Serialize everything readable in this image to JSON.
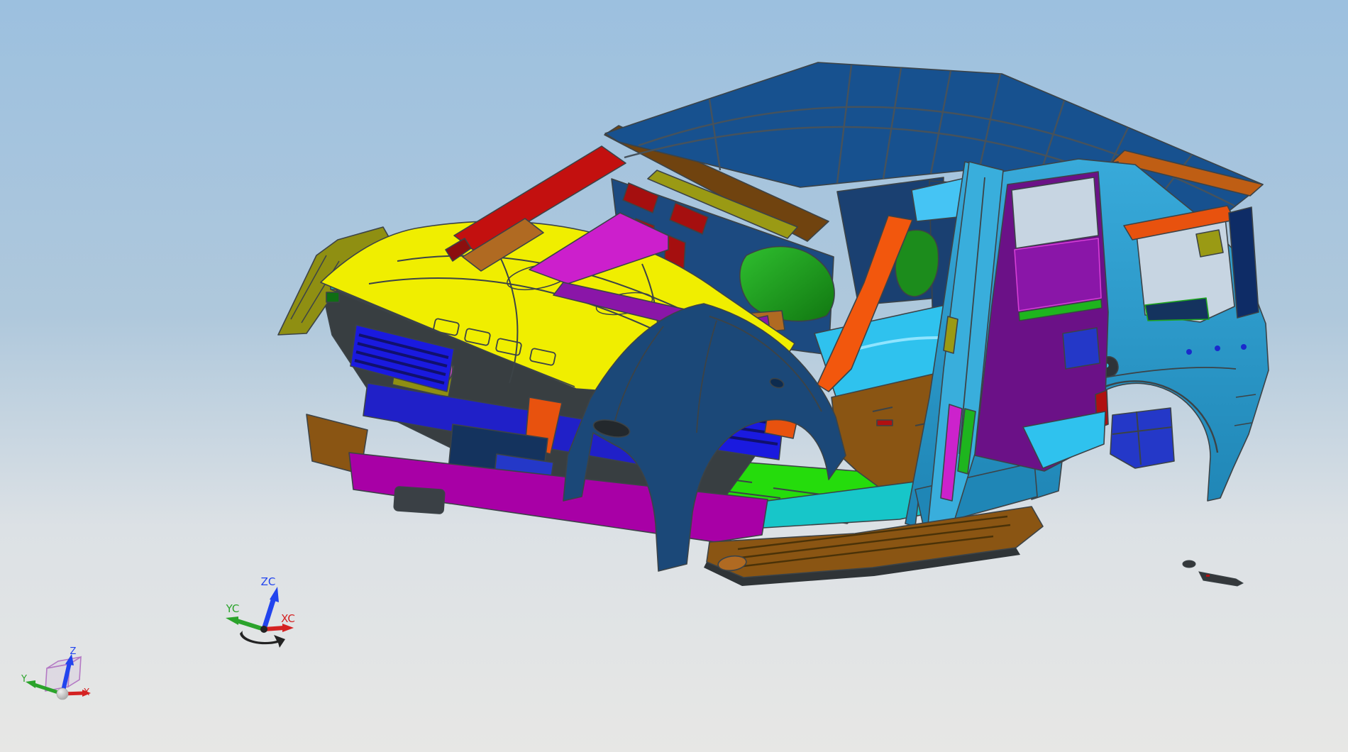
{
  "viewport": {
    "type": "cad-3d-viewport",
    "background": {
      "top": "#9CC0DF",
      "upper_mid": "#AFC8DC",
      "lower_mid": "#DCE1E5",
      "bottom": "#E7E7E5"
    }
  },
  "model": {
    "name": "suv-body-in-white",
    "description": "Multi-colored CAD body-in-white of an SUV viewed from front-left above"
  },
  "palette": {
    "edge": "#3C4347",
    "triad_blue": "#2244EE",
    "triad_green": "#2BA32B",
    "triad_red": "#D42222",
    "cube_purple": "#B479C4",
    "sphere_light": "#EFEFEF",
    "wcs_dark": "#232323"
  },
  "parts": {
    "roof": "#17518F",
    "roof_grid": "#46525C",
    "roof_edge_orange": "#BF5E14",
    "hood": "#F0EE00",
    "bodyside": "#38AADA",
    "bodyside_lower": "#1E84B4",
    "front_fender": "#1B4878",
    "a_pillar_orange": "#F2570D",
    "header_brown": "#70430F",
    "header_olive": "#9A9A14",
    "windshield_red": "#C3100F",
    "visor_red": "#A50F0F",
    "dark_red": "#8C0F0F",
    "copper": "#B06A22",
    "cowl_magenta": "#CC1FCC",
    "cowl_purple": "#8A16A8",
    "dash_blue": "#1C4A80",
    "interior_blue": "#1A4071",
    "seat_green": "#1C8C1C",
    "floor_green": "#25DC0C",
    "floor_cyan": "#2FC2EE",
    "floor_brown": "#8A5513",
    "sill_teal": "#17C6C9",
    "dark_sill": "#1F86B6",
    "grille_blue": "#1A1ADF",
    "beam_blue": "#2020C8",
    "bumper_magenta": "#A800A6",
    "fascia_dark": "#383E41",
    "olive": "#8F8F12",
    "pink_block": "#D551D0",
    "fan_pink": "#CC49CC",
    "green_strip": "#17B517",
    "bright_green": "#2ADB12",
    "orange_bracket": "#E8520E",
    "navy_box": "#14335E",
    "royal_blue": "#2438C8",
    "b_pillar": "#39AEDC",
    "sky_strip": "#45C4F4",
    "quarter_purple": "#6B1187",
    "trim_purple": "#8A16A8",
    "magenta_strip": "#CC22CC",
    "green_pillar_strip": "#1EB51E",
    "pillar_navy": "#0E2C66",
    "window_bg": "#C7D5E2",
    "recess_dark": "#2E3338",
    "dot_blue": "#1A2ACC",
    "yellow_patch": "#E8E400",
    "red_speck": "#B01010",
    "hitch_dark": "#3A4045",
    "debris": "#34383B",
    "shadow": "#2F3437",
    "teal_speck": "#17B0B0",
    "dark_green": "#0F6E14"
  },
  "triads": {
    "wcs": {
      "z": "ZC",
      "y": "YC",
      "x": "XC"
    },
    "cube": {
      "z": "Z",
      "y": "Y",
      "x": "X"
    }
  }
}
